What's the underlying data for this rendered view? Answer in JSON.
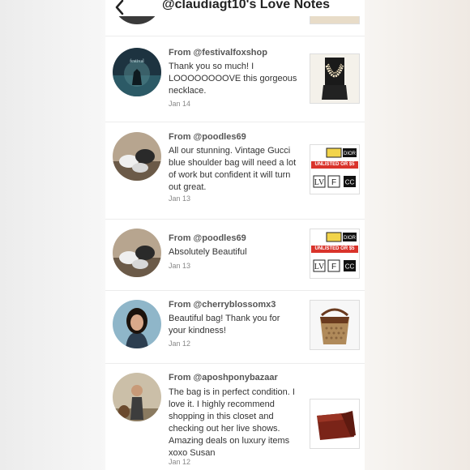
{
  "header": {
    "title": "@claudiagt10's Love Notes"
  },
  "notes": [
    {
      "from": "From @festivalfoxshop",
      "message": "Thank you so much! I LOOOOOOOOVE this gorgeous necklace.",
      "date": "Jan 14"
    },
    {
      "from": "From @poodles69",
      "message": "All our stunning. Vintage Gucci blue shoulder bag will need a lot of work but confident it will turn out great.",
      "date": "Jan 13",
      "thumb_text": "UNLISTED OR $5"
    },
    {
      "from": "From @poodles69",
      "message": "Absolutely Beautiful",
      "date": "Jan 13",
      "thumb_text": "UNLISTED OR $5"
    },
    {
      "from": "From @cherryblossomx3",
      "message": "Beautiful bag! Thank you for your kindness!",
      "date": "Jan 12"
    },
    {
      "from": "From @aposhponybazaar",
      "message": "The bag is in perfect condition. I love it. I highly recommend shopping in this closet and checking out her live shows. Amazing deals on luxury items xoxo Susan",
      "date": "Jan 12"
    }
  ]
}
